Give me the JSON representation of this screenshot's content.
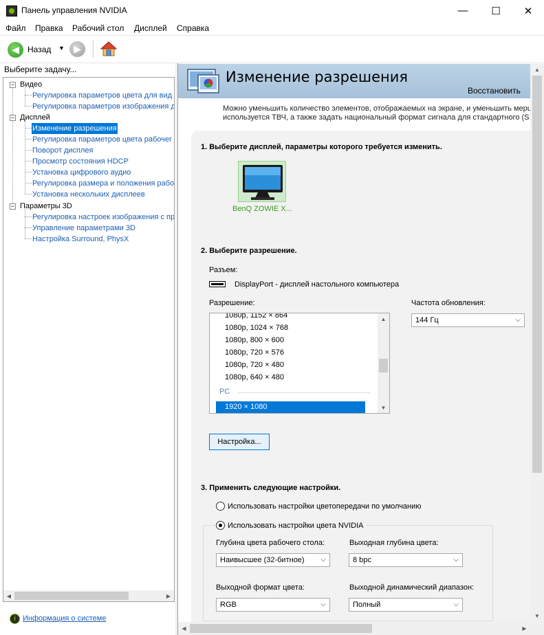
{
  "window": {
    "title": "Панель управления NVIDIA",
    "minimize_glyph": "—",
    "maximize_glyph": "☐",
    "close_glyph": "✕"
  },
  "menu": {
    "items": [
      "Файл",
      "Правка",
      "Рабочий стол",
      "Дисплей",
      "Справка"
    ]
  },
  "toolbar": {
    "back_label": "Назад",
    "back_glyph": "◀",
    "forward_glyph": "▶",
    "dropdown_glyph": "▼"
  },
  "left_panel": {
    "header": "Выберите задачу...",
    "categories": [
      {
        "label": "Видео",
        "items": [
          "Регулировка параметров цвета для вид",
          "Регулировка параметров изображения д"
        ]
      },
      {
        "label": "Дисплей",
        "items": [
          "Изменение разрешения",
          "Регулировка параметров цвета рабочег",
          "Поворот дисплея",
          "Просмотр состояния HDCP",
          "Установка цифрового аудио",
          "Регулировка размера и положения рабо",
          "Установка нескольких дисплеев"
        ]
      },
      {
        "label": "Параметры 3D",
        "items": [
          "Регулировка настроек изображения с пр",
          "Управление параметрами 3D",
          "Настройка Surround, PhysX"
        ]
      }
    ],
    "toggle_glyph": "−",
    "sysinfo_link": "Информация о системе",
    "sysinfo_glyph": "i",
    "scroll_left": "◀",
    "scroll_right": "▶"
  },
  "page": {
    "title": "Изменение разрешения",
    "restore": "Восстановить",
    "description_line1": "Можно уменьшить количество элементов, отображаемых на экране, и уменьшить мерц",
    "description_line2": "используется ТВЧ, а также задать национальный формат сигнала для стандартного (S"
  },
  "section1": {
    "title": "1. Выберите дисплей, параметры которого требуется изменить.",
    "display_name": "BenQ ZOWIE X..."
  },
  "section2": {
    "title": "2. Выберите разрешение.",
    "connector_label": "Разъем:",
    "connector_value": "DisplayPort - дисплей настольного компьютера",
    "resolution_label": "Разрешение:",
    "resolutions": [
      "1080p, 1152 × 864",
      "1080p, 1024 × 768",
      "1080p, 800 × 600",
      "1080p, 720 × 576",
      "1080p, 720 × 480",
      "1080p, 640 × 480"
    ],
    "group_label": "PC",
    "selected_resolution": "1920 × 1080",
    "refresh_label": "Частота обновления:",
    "refresh_value": "144 Гц",
    "settings_button": "Настройка..."
  },
  "section3": {
    "title": "3. Применить следующие настройки.",
    "radio_default": "Использовать настройки цветопередачи по умолчанию",
    "radio_nvidia": "Использовать настройки цвета NVIDIA",
    "desktop_depth_label": "Глубина цвета рабочего стола:",
    "desktop_depth_value": "Наивысшее (32-битное)",
    "output_depth_label": "Выходная глубина цвета:",
    "output_depth_value": "8 bpc",
    "output_format_label": "Выходной формат цвета:",
    "output_format_value": "RGB",
    "dynamic_range_label": "Выходной динамический диапазон:",
    "dynamic_range_value": "Полный"
  },
  "glyphs": {
    "chevron_down": "⌵",
    "arrow_up": "▲",
    "arrow_down": "▼",
    "arrow_left": "◀",
    "arrow_right": "▶"
  },
  "colors": {
    "link": "#1a5fb4",
    "selection": "#0078d7",
    "nvidia_green": "#76b900",
    "banner": "#bcd3e6"
  }
}
